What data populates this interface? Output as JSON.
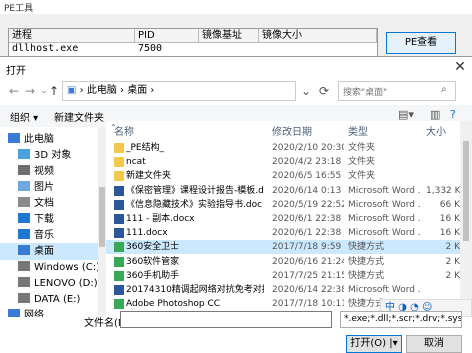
{
  "pe_window": {
    "title": "PE工具",
    "columns": [
      "进程",
      "PID",
      "镜像基址",
      "镜像大小"
    ],
    "row": [
      "dllhost.exe",
      "7500",
      "",
      ""
    ],
    "button": "PE查看"
  },
  "dialog": {
    "title": "打开",
    "breadcrumb": [
      "此电脑",
      "桌面"
    ],
    "search_placeholder": "搜索\"桌面\"",
    "toolbar": {
      "organize": "组织 ▾",
      "new_folder": "新建文件夹"
    },
    "nav_items": [
      {
        "label": "此电脑",
        "icon": "pc-icon"
      },
      {
        "label": "3D 对象",
        "icon": "cube-icon"
      },
      {
        "label": "视频",
        "icon": "video-icon"
      },
      {
        "label": "图片",
        "icon": "picture-icon"
      },
      {
        "label": "文档",
        "icon": "document-icon"
      },
      {
        "label": "下载",
        "icon": "download-icon"
      },
      {
        "label": "音乐",
        "icon": "music-icon"
      },
      {
        "label": "桌面",
        "icon": "desktop-icon",
        "selected": true
      },
      {
        "label": "Windows (C:)",
        "icon": "drive-icon"
      },
      {
        "label": "LENOVO (D:)",
        "icon": "drive-icon"
      },
      {
        "label": "DATA (E:)",
        "icon": "drive-icon"
      },
      {
        "label": "网络",
        "icon": "network-icon"
      }
    ],
    "list_headers": {
      "name": "名称",
      "date": "修改日期",
      "type": "类型",
      "size": "大小"
    },
    "files": [
      {
        "name": "_PE结构_",
        "date": "2020/2/10 20:30",
        "type": "文件夹",
        "size": "",
        "kind": "folder"
      },
      {
        "name": "ncat",
        "date": "2020/4/2 23:18",
        "type": "文件夹",
        "size": "",
        "kind": "folder"
      },
      {
        "name": "新建文件夹",
        "date": "2020/6/5 16:55",
        "type": "文件夹",
        "size": "",
        "kind": "folder"
      },
      {
        "name": "《保密管理》课程设计报告-模板.doc",
        "date": "2020/6/14 0:13",
        "type": "Microsoft Word ...",
        "size": "1,332 K",
        "kind": "doc"
      },
      {
        "name": "《信息隐藏技术》实验指导书.doc",
        "date": "2020/5/19 22:52",
        "type": "Microsoft Word ...",
        "size": "66 K",
        "kind": "doc"
      },
      {
        "name": "111 - 副本.docx",
        "date": "2020/6/1 22:38",
        "type": "Microsoft Word ...",
        "size": "16 K",
        "kind": "doc"
      },
      {
        "name": "111.docx",
        "date": "2020/6/1 22:38",
        "type": "Microsoft Word ...",
        "size": "16 K",
        "kind": "doc"
      },
      {
        "name": "360安全卫士",
        "date": "2017/7/18 9:59",
        "type": "快捷方式",
        "size": "2 K",
        "kind": "shortcut",
        "selected": true
      },
      {
        "name": "360软件管家",
        "date": "2020/6/16 21:24",
        "type": "快捷方式",
        "size": "2 K",
        "kind": "shortcut"
      },
      {
        "name": "360手机助手",
        "date": "2017/7/25 21:15",
        "type": "快捷方式",
        "size": "2 K",
        "kind": "shortcut"
      },
      {
        "name": "20174310精调起网络对抗免考对抗——...",
        "date": "2020/6/14 22:38",
        "type": "Microsoft Word ...",
        "size": "",
        "kind": "doc"
      },
      {
        "name": "Adobe Photoshop CC",
        "date": "2017/7/18 10:11",
        "type": "快捷方式",
        "size": "",
        "kind": "shortcut"
      }
    ],
    "ime_text": "中 ◑ ◔ ☺",
    "filename_label": "文件名(N):",
    "filename_value": "",
    "filter": "*.exe;*.dll;*.scr;*.drv;*.sys",
    "open_label": "打开(O)",
    "cancel_label": "取消"
  }
}
